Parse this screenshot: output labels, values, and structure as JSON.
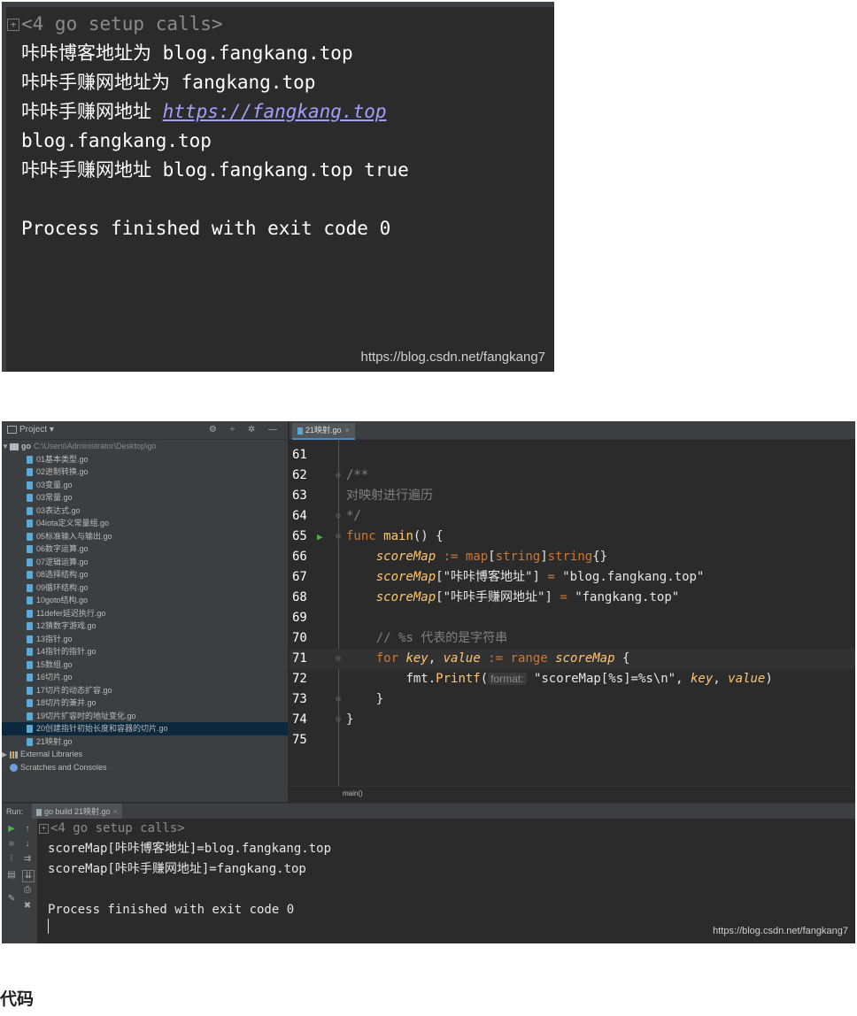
{
  "top_console": {
    "setup_line": "<4 go setup calls>",
    "line1_prefix": "咔咔博客地址为 ",
    "line1_value": "blog.fangkang.top",
    "line2_prefix": "咔咔手赚网地址为 ",
    "line2_value": "fangkang.top",
    "line3_prefix": "咔咔手赚网地址 ",
    "line3_link": "https://fangkang.top",
    "line4": "blog.fangkang.top",
    "line5_prefix": "咔咔手赚网地址 ",
    "line5_value": "blog.fangkang.top true",
    "exit_line": "Process finished with exit code 0",
    "watermark": "https://blog.csdn.net/fangkang7"
  },
  "project": {
    "title": "Project ▾",
    "tools": "⚙ ÷ ✲ —",
    "root_name": "go",
    "root_path": "C:\\Users\\Administrator\\Desktop\\go",
    "files": [
      "01基本类型.go",
      "02进制转换.go",
      "03变量.go",
      "03常量.go",
      "03表达式.go",
      "04iota定义常量组.go",
      "05标准输入与输出.go",
      "06数字运算.go",
      "07逻辑运算.go",
      "08选择结构.go",
      "09循环结构.go",
      "10goto结构.go",
      "11defer延迟执行.go",
      "12猜数字游戏.go",
      "13指针.go",
      "14指针的指针.go",
      "15数组.go",
      "16切片.go",
      "17切片的动态扩容.go",
      "18切片的兼并.go",
      "19切片扩容时的地址变化.go",
      "20创建指针初始长度和容器的切片.go",
      "21映射.go"
    ],
    "external_libraries": "External Libraries",
    "scratches": "Scratches and Consoles"
  },
  "editor": {
    "tab_label": "21映射.go",
    "breadcrumb": "main()",
    "line_numbers": [
      "61",
      "62",
      "63",
      "64",
      "65",
      "66",
      "67",
      "68",
      "69",
      "70",
      "71",
      "72",
      "73",
      "74",
      "75"
    ]
  },
  "run": {
    "label": "Run:",
    "tab_label": "go build 21映射.go",
    "setup_line": "<4 go setup calls>",
    "out1": "scoreMap[咔咔博客地址]=blog.fangkang.top",
    "out2": "scoreMap[咔咔手赚网地址]=fangkang.top",
    "exit_line": "Process finished with exit code 0",
    "watermark": "https://blog.csdn.net/fangkang7"
  },
  "caption": "代码"
}
